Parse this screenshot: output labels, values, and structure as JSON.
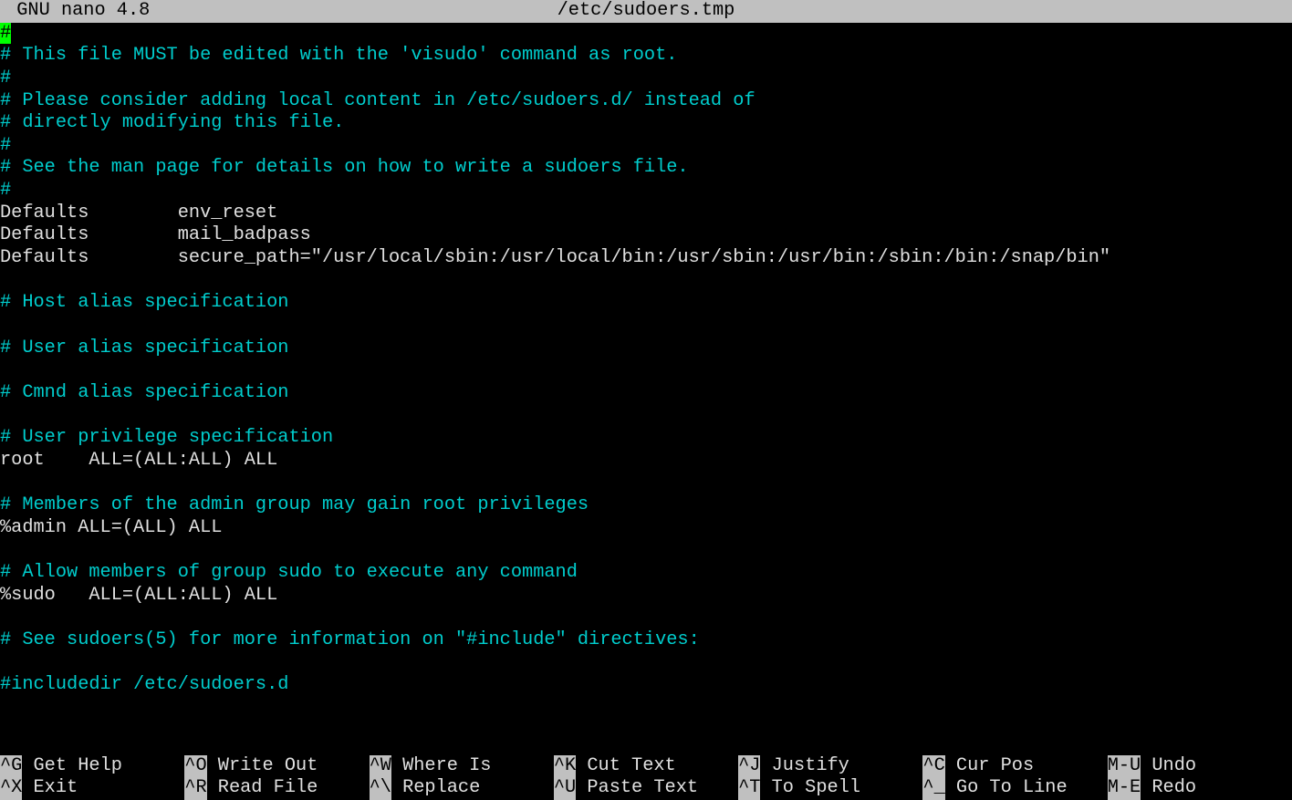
{
  "titlebar": {
    "app": "GNU nano 4.8",
    "filename": "/etc/sudoers.tmp"
  },
  "lines": [
    {
      "raw": "#",
      "c": "comment",
      "cursor": true
    },
    {
      "raw": "# This file MUST be edited with the 'visudo' command as root.",
      "c": "comment"
    },
    {
      "raw": "#",
      "c": "comment"
    },
    {
      "raw": "# Please consider adding local content in /etc/sudoers.d/ instead of",
      "c": "comment"
    },
    {
      "raw": "# directly modifying this file.",
      "c": "comment"
    },
    {
      "raw": "#",
      "c": "comment"
    },
    {
      "raw": "# See the man page for details on how to write a sudoers file.",
      "c": "comment"
    },
    {
      "raw": "#",
      "c": "comment"
    },
    {
      "raw": "Defaults        env_reset",
      "c": "plain"
    },
    {
      "raw": "Defaults        mail_badpass",
      "c": "plain"
    },
    {
      "raw": "Defaults        secure_path=\"/usr/local/sbin:/usr/local/bin:/usr/sbin:/usr/bin:/sbin:/bin:/snap/bin\"",
      "c": "plain"
    },
    {
      "raw": "",
      "c": "plain"
    },
    {
      "raw": "# Host alias specification",
      "c": "comment"
    },
    {
      "raw": "",
      "c": "plain"
    },
    {
      "raw": "# User alias specification",
      "c": "comment"
    },
    {
      "raw": "",
      "c": "plain"
    },
    {
      "raw": "# Cmnd alias specification",
      "c": "comment"
    },
    {
      "raw": "",
      "c": "plain"
    },
    {
      "raw": "# User privilege specification",
      "c": "comment"
    },
    {
      "raw": "root    ALL=(ALL:ALL) ALL",
      "c": "plain"
    },
    {
      "raw": "",
      "c": "plain"
    },
    {
      "raw": "# Members of the admin group may gain root privileges",
      "c": "comment"
    },
    {
      "raw": "%admin ALL=(ALL) ALL",
      "c": "plain"
    },
    {
      "raw": "",
      "c": "plain"
    },
    {
      "raw": "# Allow members of group sudo to execute any command",
      "c": "comment"
    },
    {
      "raw": "%sudo   ALL=(ALL:ALL) ALL",
      "c": "plain"
    },
    {
      "raw": "",
      "c": "plain"
    },
    {
      "raw": "# See sudoers(5) for more information on \"#include\" directives:",
      "c": "comment"
    },
    {
      "raw": "",
      "c": "plain"
    },
    {
      "raw": "#includedir /etc/sudoers.d",
      "c": "comment"
    }
  ],
  "shortcuts_row1": [
    {
      "key": "^G",
      "label": " Get Help   "
    },
    {
      "key": "^O",
      "label": " Write Out  "
    },
    {
      "key": "^W",
      "label": " Where Is   "
    },
    {
      "key": "^K",
      "label": " Cut Text   "
    },
    {
      "key": "^J",
      "label": " Justify    "
    },
    {
      "key": "^C",
      "label": " Cur Pos    "
    },
    {
      "key": "M-U",
      "label": " Undo"
    }
  ],
  "shortcuts_row2": [
    {
      "key": "^X",
      "label": " Exit       "
    },
    {
      "key": "^R",
      "label": " Read File  "
    },
    {
      "key": "^\\",
      "label": " Replace    "
    },
    {
      "key": "^U",
      "label": " Paste Text "
    },
    {
      "key": "^T",
      "label": " To Spell   "
    },
    {
      "key": "^_",
      "label": " Go To Line "
    },
    {
      "key": "M-E",
      "label": " Redo"
    }
  ]
}
